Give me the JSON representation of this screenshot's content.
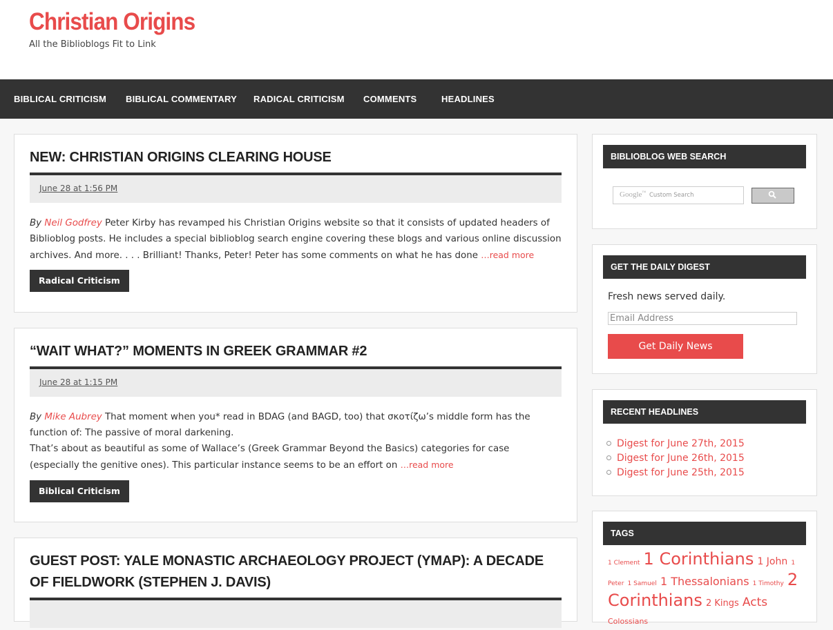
{
  "site": {
    "title": "Christian Origins",
    "description": "All the Biblioblogs Fit to Link"
  },
  "nav": {
    "items": [
      "BIBLICAL CRITICISM",
      "BIBLICAL COMMENTARY",
      "RADICAL CRITICISM",
      "COMMENTS",
      "HEADLINES"
    ]
  },
  "posts": [
    {
      "title": "NEW: CHRISTIAN ORIGINS CLEARING HOUSE",
      "date": "June 28 at 1:56 PM",
      "by": "By",
      "author": "Neil Godfrey",
      "excerpt": " Peter Kirby has revamped his Christian Origins website so that it consists of updated headers of Biblioblog posts. He includes a special biblioblog search engine covering these blogs and various online discussion archives. And more. . . . Brilliant! Thanks, Peter! Peter has some comments on what he has done ",
      "read_more": "…read more",
      "category": "Radical Criticism"
    },
    {
      "title": "“WAIT WHAT?” MOMENTS IN GREEK GRAMMAR #2",
      "date": "June 28 at 1:15 PM",
      "by": "By",
      "author": "Mike Aubrey",
      "excerpt_line1": " That moment when you* read in BDAG (and BAGD, too) that σκοτίζω’s middle form has the function of: The passive of moral darkening.",
      "excerpt_line2": "That’s about as beautiful as some of Wallace’s (Greek Grammar Beyond the Basics) categories for case (especially the genitive ones). This particular instance seems to be an effort on ",
      "read_more": "…read more",
      "category": "Biblical Criticism"
    },
    {
      "title": "GUEST POST: YALE MONASTIC ARCHAEOLOGY PROJECT (YMAP): A DECADE OF FIELDWORK (STEPHEN J. DAVIS)"
    }
  ],
  "sidebar": {
    "search": {
      "title": "BIBLIOBLOG WEB SEARCH",
      "google": "Google",
      "trademark": "™",
      "placeholder": "Custom Search",
      "button_icon": "search-icon"
    },
    "digest": {
      "title": "GET THE DAILY DIGEST",
      "text": "Fresh news served daily.",
      "email_placeholder": "Email Address",
      "button": "Get Daily News"
    },
    "headlines": {
      "title": "RECENT HEADLINES",
      "items": [
        "Digest for June 27th, 2015",
        "Digest for June 26th, 2015",
        "Digest for June 25th, 2015"
      ]
    },
    "tags": {
      "title": "TAGS",
      "items": [
        {
          "label": "1 Clement",
          "size": 9
        },
        {
          "label": "1 Corinthians",
          "size": 24
        },
        {
          "label": "1 John",
          "size": 14
        },
        {
          "label": "1 Peter",
          "size": 9
        },
        {
          "label": "1 Samuel",
          "size": 9
        },
        {
          "label": "1 Thessalonians",
          "size": 16
        },
        {
          "label": "1 Timothy",
          "size": 9
        },
        {
          "label": "2 Corinthians",
          "size": 24
        },
        {
          "label": "2 Kings",
          "size": 13
        },
        {
          "label": "Acts",
          "size": 17
        },
        {
          "label": "Colossians",
          "size": 11
        }
      ]
    }
  },
  "colors": {
    "accent": "#e84b4b",
    "dark": "#333333",
    "background": "#f7f7f7"
  }
}
